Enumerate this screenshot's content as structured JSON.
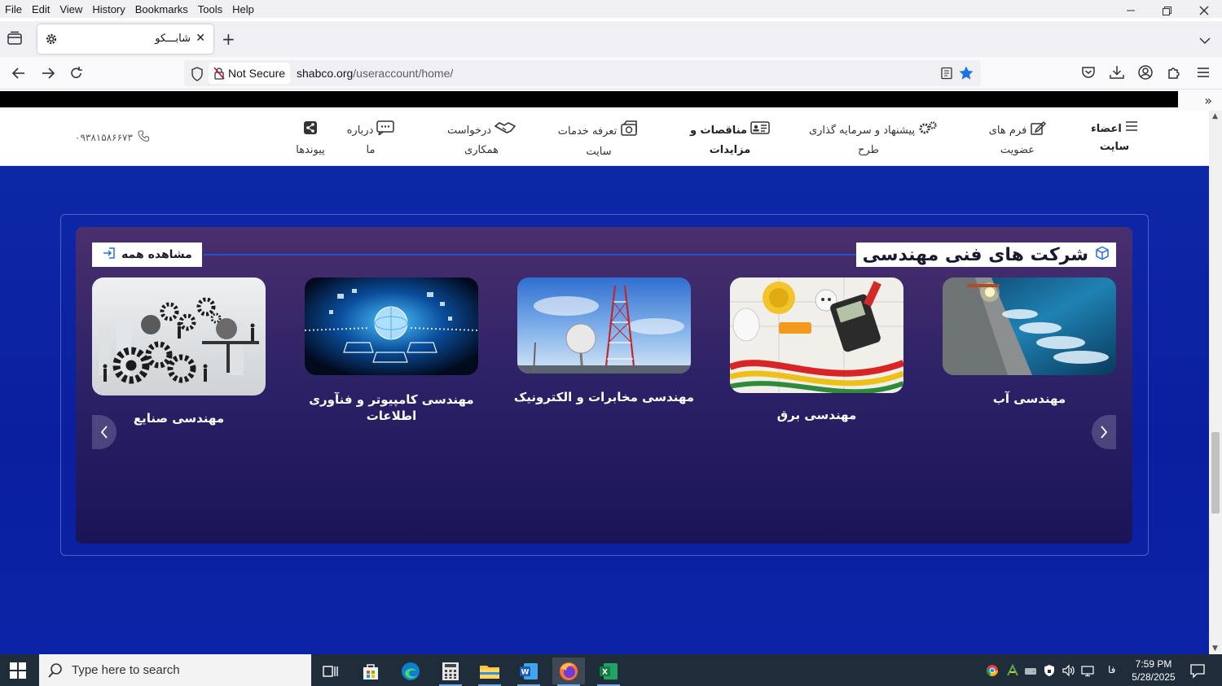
{
  "menubar": {
    "items": [
      "File",
      "Edit",
      "View",
      "History",
      "Bookmarks",
      "Tools",
      "Help"
    ]
  },
  "tab": {
    "title": "شابـــکو"
  },
  "urlbar": {
    "security_label": "Not Secure",
    "host": "shabco.org",
    "path": "/useraccount/home/"
  },
  "site_header": {
    "phone": "۰۹۳۸۱۵۸۶۶۷۳",
    "items": [
      {
        "line1": "اعضاء",
        "line2": "سایت",
        "icon": "menu-icon"
      },
      {
        "line1": "فرم های",
        "line2": "عضویت",
        "icon": "edit-icon"
      },
      {
        "line1": "پیشنهاد و سرمایه گذاری",
        "line2": "طرح",
        "icon": "gears-icon"
      },
      {
        "line1": "مناقصات و",
        "line2": "مزایدات",
        "icon": "id-card-icon"
      },
      {
        "line1": "تعرفه خدمات",
        "line2": "سایت",
        "icon": "money-icon"
      },
      {
        "line1": "درخواست",
        "line2": "همکاری",
        "icon": "handshake-icon"
      },
      {
        "line1": "درباره",
        "line2": "ما",
        "icon": "chat-icon"
      },
      {
        "line1": "",
        "line2": "پیوندها",
        "icon": "share-icon"
      }
    ]
  },
  "section": {
    "title": "شرکت های فنی مهندسی",
    "view_all": "مشاهده همه"
  },
  "cards": [
    {
      "label": "مهندسی صنایع",
      "image": "gears-teamwork"
    },
    {
      "label": "مهندسی کامپیوتر و فنآوری اطلاعات",
      "image": "network-laptops"
    },
    {
      "label": "مهندسی مخابرات و الکترونیک",
      "image": "telecom-tower"
    },
    {
      "label": "مهندسی برق",
      "image": "electrical-tools"
    },
    {
      "label": "مهندسی آب",
      "image": "dam-spillway"
    }
  ],
  "taskbar": {
    "search_placeholder": "Type here to search",
    "lang": "فا",
    "time": "7:59 PM",
    "date": "5/28/2025"
  },
  "colors": {
    "page_bg": "#0d2aa8",
    "panel_top": "#4a2f6e",
    "panel_bottom": "#1a1457",
    "accent": "#2450c8",
    "star": "#1a73e8"
  }
}
